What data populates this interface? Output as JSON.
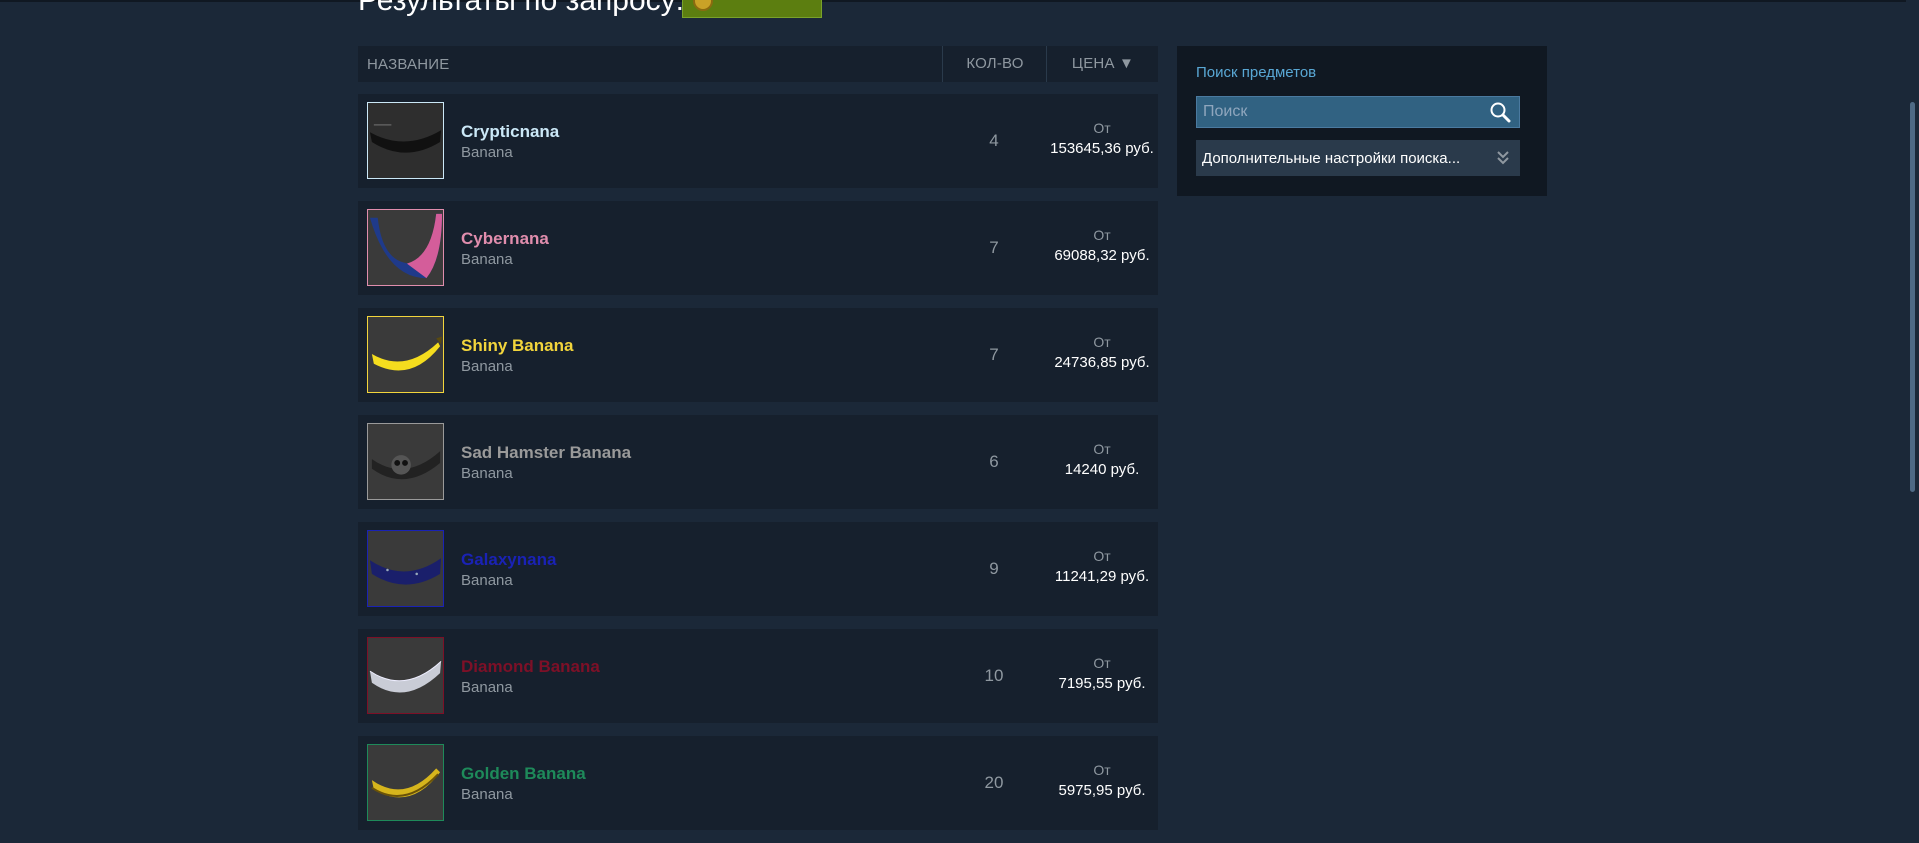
{
  "page": {
    "heading": "Результаты по запросу:"
  },
  "header": {
    "col_name": "НАЗВАНИЕ",
    "col_qty": "КОЛ-ВО",
    "col_price": "ЦЕНА ▼"
  },
  "items": [
    {
      "name": "Crypticnana",
      "game": "Banana",
      "qty": "4",
      "price_prefix": "От",
      "price": "153645,36 руб.",
      "color": "#cbe8f7",
      "border": "#cbe8f7",
      "icon": "crypticnana-item-icon"
    },
    {
      "name": "Cybernana",
      "game": "Banana",
      "qty": "7",
      "price_prefix": "От",
      "price": "69088,32 руб.",
      "color": "#e08dad",
      "border": "#e08dad",
      "icon": "cybernana-item-icon"
    },
    {
      "name": "Shiny Banana",
      "game": "Banana",
      "qty": "7",
      "price_prefix": "От",
      "price": "24736,85 руб.",
      "color": "#f2d53c",
      "border": "#f2d53c",
      "icon": "shiny-banana-item-icon"
    },
    {
      "name": "Sad Hamster Banana",
      "game": "Banana",
      "qty": "6",
      "price_prefix": "От",
      "price": "14240 руб.",
      "color": "#9a9a9a",
      "border": "#9a9a9a",
      "icon": "sad-hamster-banana-item-icon"
    },
    {
      "name": "Galaxynana",
      "game": "Banana",
      "qty": "9",
      "price_prefix": "От",
      "price": "11241,29 руб.",
      "color": "#1a22b5",
      "border": "#1a22b5",
      "icon": "galaxynana-item-icon"
    },
    {
      "name": "Diamond Banana",
      "game": "Banana",
      "qty": "10",
      "price_prefix": "От",
      "price": "7195,55 руб.",
      "color": "#7d1027",
      "border": "#7d1027",
      "icon": "diamond-banana-item-icon"
    },
    {
      "name": "Golden Banana",
      "game": "Banana",
      "qty": "20",
      "price_prefix": "От",
      "price": "5975,95 руб.",
      "color": "#1e8a5a",
      "border": "#1e8a5a",
      "icon": "golden-banana-item-icon"
    }
  ],
  "sidebar": {
    "title": "Поиск предметов",
    "search_placeholder": "Поиск",
    "advanced_label": "Дополнительные настройки поиска..."
  }
}
